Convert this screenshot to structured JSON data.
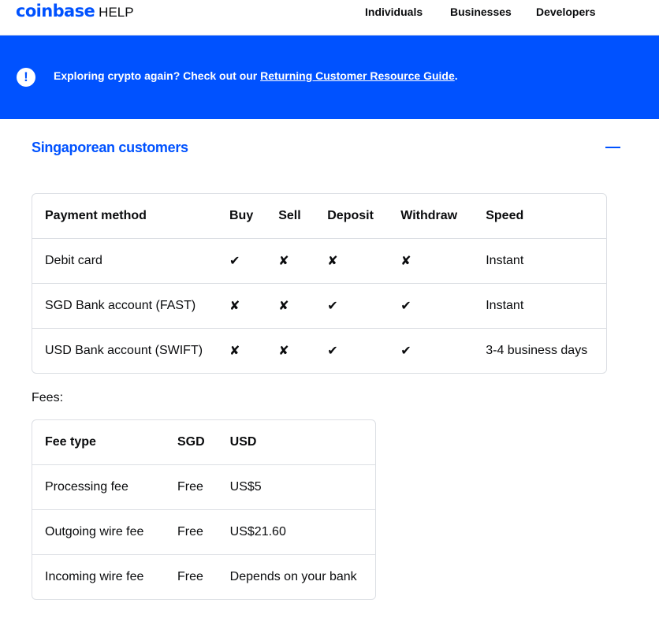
{
  "header": {
    "logo_brand": "coinbase",
    "logo_help": "HELP",
    "nav": [
      "Individuals",
      "Businesses",
      "Developers"
    ]
  },
  "banner": {
    "icon": "!",
    "text_prefix": "Exploring crypto again? Check out our ",
    "link_text": "Returning Customer Resource Guide",
    "text_suffix": "."
  },
  "section": {
    "title": "Singaporean customers",
    "collapse_icon": "minus-icon"
  },
  "payment_table": {
    "headers": [
      "Payment method",
      "Buy",
      "Sell",
      "Deposit",
      "Withdraw",
      "Speed"
    ],
    "rows": [
      [
        "Debit card",
        "✔",
        "✘",
        "✘",
        "✘",
        "Instant"
      ],
      [
        "SGD Bank account (FAST)",
        "✘",
        "✘",
        "✔",
        "✔",
        "Instant"
      ],
      [
        "USD Bank account (SWIFT)",
        "✘",
        "✘",
        "✔",
        "✔",
        "3-4 business days"
      ]
    ]
  },
  "fees_label": "Fees:",
  "fee_table": {
    "headers": [
      "Fee type",
      "SGD",
      "USD"
    ],
    "rows": [
      [
        "Processing fee",
        "Free",
        "US$5"
      ],
      [
        "Outgoing wire fee",
        "Free",
        "US$21.60"
      ],
      [
        "Incoming wire fee",
        "Free",
        "Depends on your bank"
      ]
    ]
  },
  "colors": {
    "brand": "#0052ff",
    "border": "#dcdfe4",
    "text": "#0a0b0d"
  }
}
